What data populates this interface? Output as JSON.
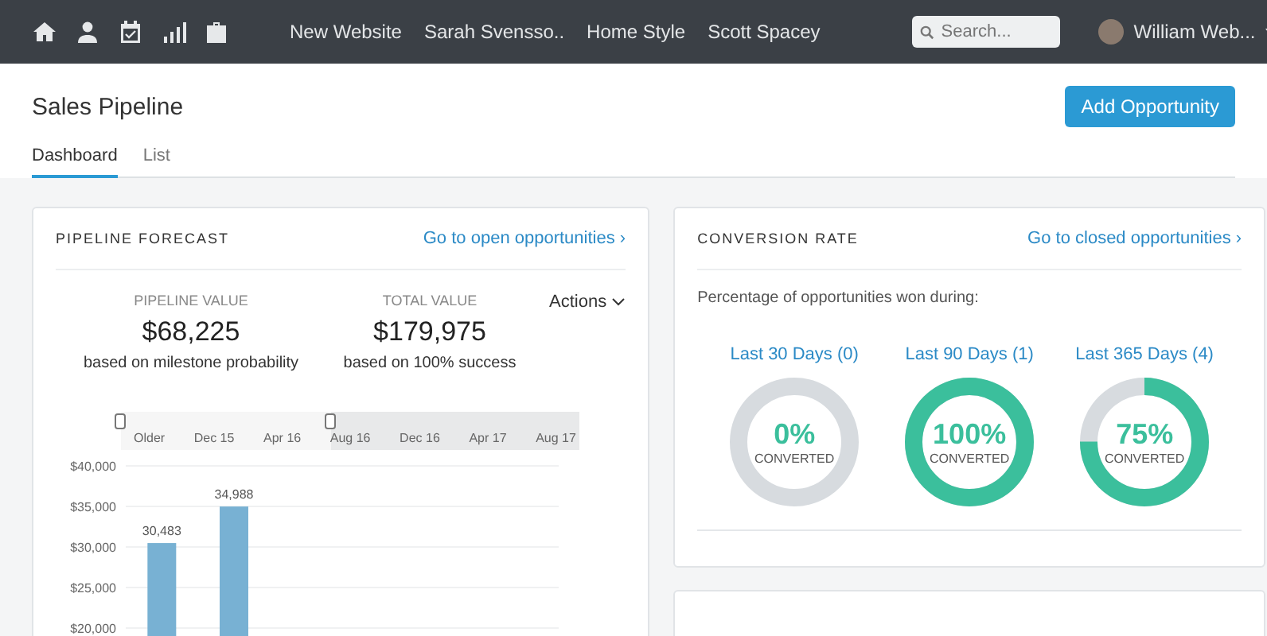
{
  "top_nav": {
    "links": [
      "New Website",
      "Sarah Svensso..",
      "Home Style",
      "Scott Spacey"
    ],
    "search": {
      "placeholder": "Search..."
    },
    "user": {
      "name": "William Web..."
    }
  },
  "header": {
    "title": "Sales Pipeline",
    "button": "Add Opportunity",
    "tabs": [
      {
        "label": "Dashboard",
        "selected": true
      },
      {
        "label": "List",
        "selected": false
      }
    ]
  },
  "pipeline_forecast": {
    "title": "PIPELINE FORECAST",
    "link": "Go to open opportunities ›",
    "stats": [
      {
        "label": "PIPELINE VALUE",
        "value": "$68,225",
        "note": "based on milestone probability"
      },
      {
        "label": "TOTAL VALUE",
        "value": "$179,975",
        "note": "based on 100% success"
      }
    ],
    "actions": "Actions",
    "range_selector": {
      "labels": [
        "Older",
        "Dec 15",
        "Apr 16",
        "Aug 16",
        "Dec 16",
        "Apr 17",
        "Aug 17"
      ],
      "level": 0.46
    },
    "chart_data": {
      "type": "bar",
      "values": [
        30483,
        34988,
        null,
        null,
        null,
        null
      ],
      "data_labels": true,
      "grid": true,
      "ylim": [
        0,
        40000
      ],
      "yticks": [
        {
          "value": 20000,
          "label": "$20,000"
        },
        {
          "value": 25000,
          "label": "$25,000"
        },
        {
          "value": 30000,
          "label": "$30,000"
        },
        {
          "value": 35000,
          "label": "$35,000"
        },
        {
          "value": 40000,
          "label": "$40,000"
        }
      ],
      "value_labels": [
        "30,483",
        "34,988",
        null,
        null,
        null,
        null
      ]
    }
  },
  "conversion_rate": {
    "title": "CONVERSION RATE",
    "link": "Go to closed opportunities ›",
    "subtitle": "Percentage of opportunities won during:",
    "periods": [
      {
        "label": "Last 30 Days (0)",
        "percent": "0%",
        "caption": "CONVERTED",
        "level": 0
      },
      {
        "label": "Last 90 Days (1)",
        "percent": "100%",
        "caption": "CONVERTED",
        "level": 1
      },
      {
        "label": "Last 365 Days (4)",
        "percent": "75%",
        "caption": "CONVERTED",
        "level": 0.75
      }
    ]
  }
}
